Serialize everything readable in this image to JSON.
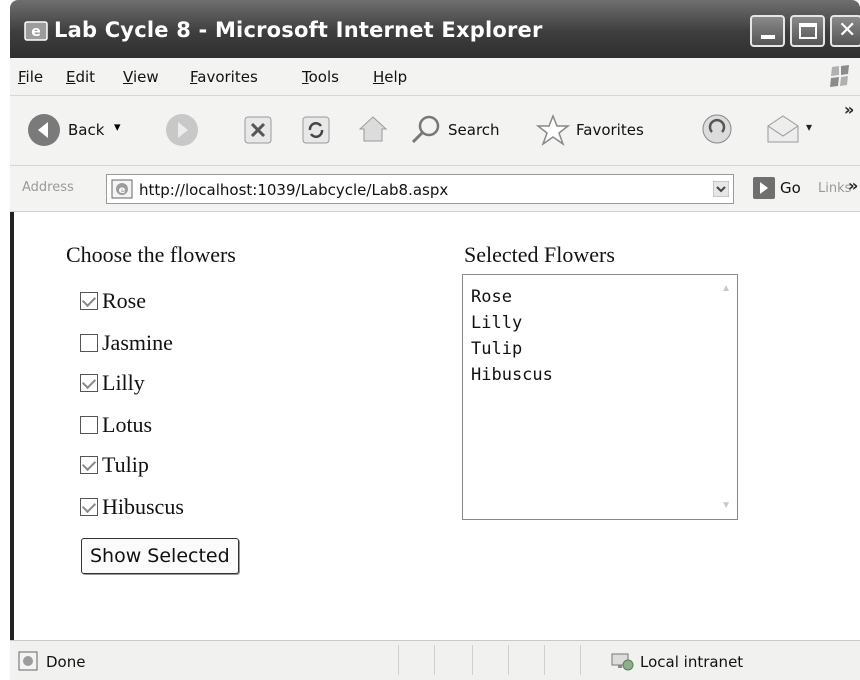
{
  "window": {
    "title": "Lab Cycle 8 - Microsoft Internet Explorer",
    "controls": [
      "minimize-icon",
      "maximize-icon",
      "close-icon"
    ]
  },
  "menu": {
    "items": [
      "File",
      "Edit",
      "View",
      "Favorites",
      "Tools",
      "Help"
    ]
  },
  "toolbar": {
    "back_label": "Back",
    "search_label": "Search",
    "favorites_label": "Favorites",
    "overflow": "»"
  },
  "address": {
    "label": "Address",
    "url": "http://localhost:1039/Labcycle/Lab8.aspx",
    "go_label": "Go",
    "links_label": "Links",
    "overflow": "»"
  },
  "page": {
    "choose_label": "Choose the flowers",
    "flowers": [
      {
        "label": "Rose",
        "checked": true
      },
      {
        "label": "Jasmine",
        "checked": false
      },
      {
        "label": "Lilly",
        "checked": true
      },
      {
        "label": "Lotus",
        "checked": false
      },
      {
        "label": "Tulip",
        "checked": true
      },
      {
        "label": "Hibuscus",
        "checked": true
      }
    ],
    "show_button": "Show Selected",
    "selected_label": "Selected Flowers",
    "selected_lines": [
      "Rose",
      "Lilly",
      "Tulip",
      "Hibuscus"
    ]
  },
  "status": {
    "text": "Done",
    "zone": "Local intranet"
  },
  "colors": {
    "titlebar": "#3e3e3e",
    "chrome": "#f3f3f1",
    "text": "#111111"
  }
}
